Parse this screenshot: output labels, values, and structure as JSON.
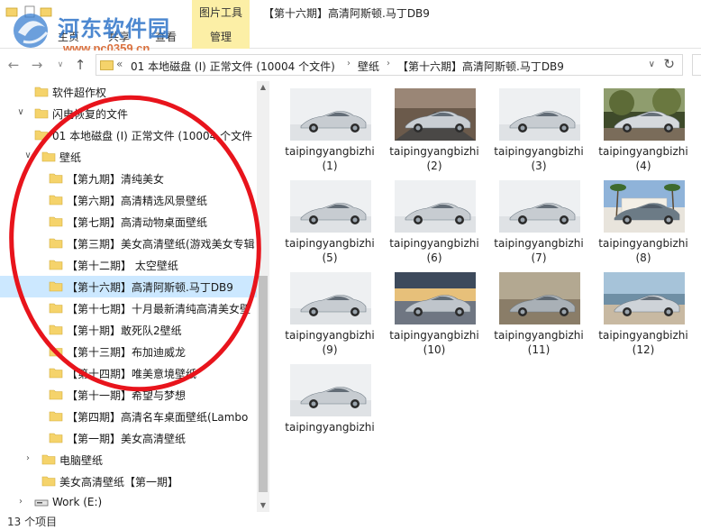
{
  "ribbon": {
    "tools_group_title": "图片工具",
    "window_title": "【第十六期】高清阿斯顿.马丁DB9",
    "tabs": [
      "主页",
      "共享",
      "查看"
    ],
    "manage_tab": "管理"
  },
  "watermark": {
    "title": "河东软件园",
    "url": "www.pc0359.cn"
  },
  "address": {
    "crumbs": [
      "01 本地磁盘 (I) 正常文件 (10004 个文件)",
      "壁纸",
      "【第十六期】高清阿斯顿.马丁DB9"
    ],
    "overflow": "«"
  },
  "tree": [
    {
      "label": "软件超作权",
      "arrow": "",
      "indent": 0
    },
    {
      "label": "闪电恢复的文件",
      "arrow": "v",
      "indent": 0
    },
    {
      "label": "01 本地磁盘 (I) 正常文件 (10004 个文件",
      "arrow": "",
      "indent": 1
    },
    {
      "label": "壁纸",
      "arrow": "v",
      "indent": 2
    },
    {
      "label": "【第九期】清纯美女",
      "arrow": "",
      "indent": 3
    },
    {
      "label": "【第六期】高清精选风景壁纸",
      "arrow": "",
      "indent": 3
    },
    {
      "label": "【第七期】高清动物桌面壁纸",
      "arrow": "",
      "indent": 3
    },
    {
      "label": "【第三期】美女高清壁纸(游戏美女专辑",
      "arrow": "",
      "indent": 3
    },
    {
      "label": "【第十二期】 太空壁纸",
      "arrow": "",
      "indent": 3
    },
    {
      "label": "【第十六期】高清阿斯顿.马丁DB9",
      "arrow": "",
      "indent": 3,
      "selected": true
    },
    {
      "label": "【第十七期】十月最新清纯高清美女壁",
      "arrow": "",
      "indent": 3
    },
    {
      "label": "【第十期】敢死队2壁纸",
      "arrow": "",
      "indent": 3
    },
    {
      "label": "【第十三期】布加迪威龙",
      "arrow": "",
      "indent": 3
    },
    {
      "label": "【第十四期】唯美意境壁纸",
      "arrow": "",
      "indent": 3
    },
    {
      "label": "【第十一期】希望与梦想",
      "arrow": "",
      "indent": 3
    },
    {
      "label": "【第四期】高清名车桌面壁纸(Lambo",
      "arrow": "",
      "indent": 3
    },
    {
      "label": "【第一期】美女高清壁纸",
      "arrow": "",
      "indent": 3
    },
    {
      "label": "电脑壁纸",
      "arrow": ">",
      "indent": 2
    },
    {
      "label": "美女高清壁纸【第一期】",
      "arrow": "",
      "indent": 2
    },
    {
      "label": "Work (E:)",
      "arrow": ">",
      "indent": 0,
      "drive": true
    }
  ],
  "files": [
    {
      "name": "taipingyangbizhi (1)",
      "scene": "studio"
    },
    {
      "name": "taipingyangbizhi (2)",
      "scene": "road"
    },
    {
      "name": "taipingyangbizhi (3)",
      "scene": "studio"
    },
    {
      "name": "taipingyangbizhi (4)",
      "scene": "forest"
    },
    {
      "name": "taipingyangbizhi (5)",
      "scene": "studio"
    },
    {
      "name": "taipingyangbizhi (6)",
      "scene": "studio"
    },
    {
      "name": "taipingyangbizhi (7)",
      "scene": "studio"
    },
    {
      "name": "taipingyangbizhi (8)",
      "scene": "palms"
    },
    {
      "name": "taipingyangbizhi (9)",
      "scene": "studio"
    },
    {
      "name": "taipingyangbizhi (10)",
      "scene": "sunset"
    },
    {
      "name": "taipingyangbizhi (11)",
      "scene": "dusk"
    },
    {
      "name": "taipingyangbizhi (12)",
      "scene": "harbor"
    },
    {
      "name": "taipingyangbizhi",
      "scene": "studio"
    }
  ],
  "status": {
    "count_text": "13 个项目"
  },
  "colors": {
    "selection": "#cce8ff",
    "folder": "#f5d36b",
    "tools_tab": "#fcefa6",
    "annotation": "#e8141c"
  }
}
